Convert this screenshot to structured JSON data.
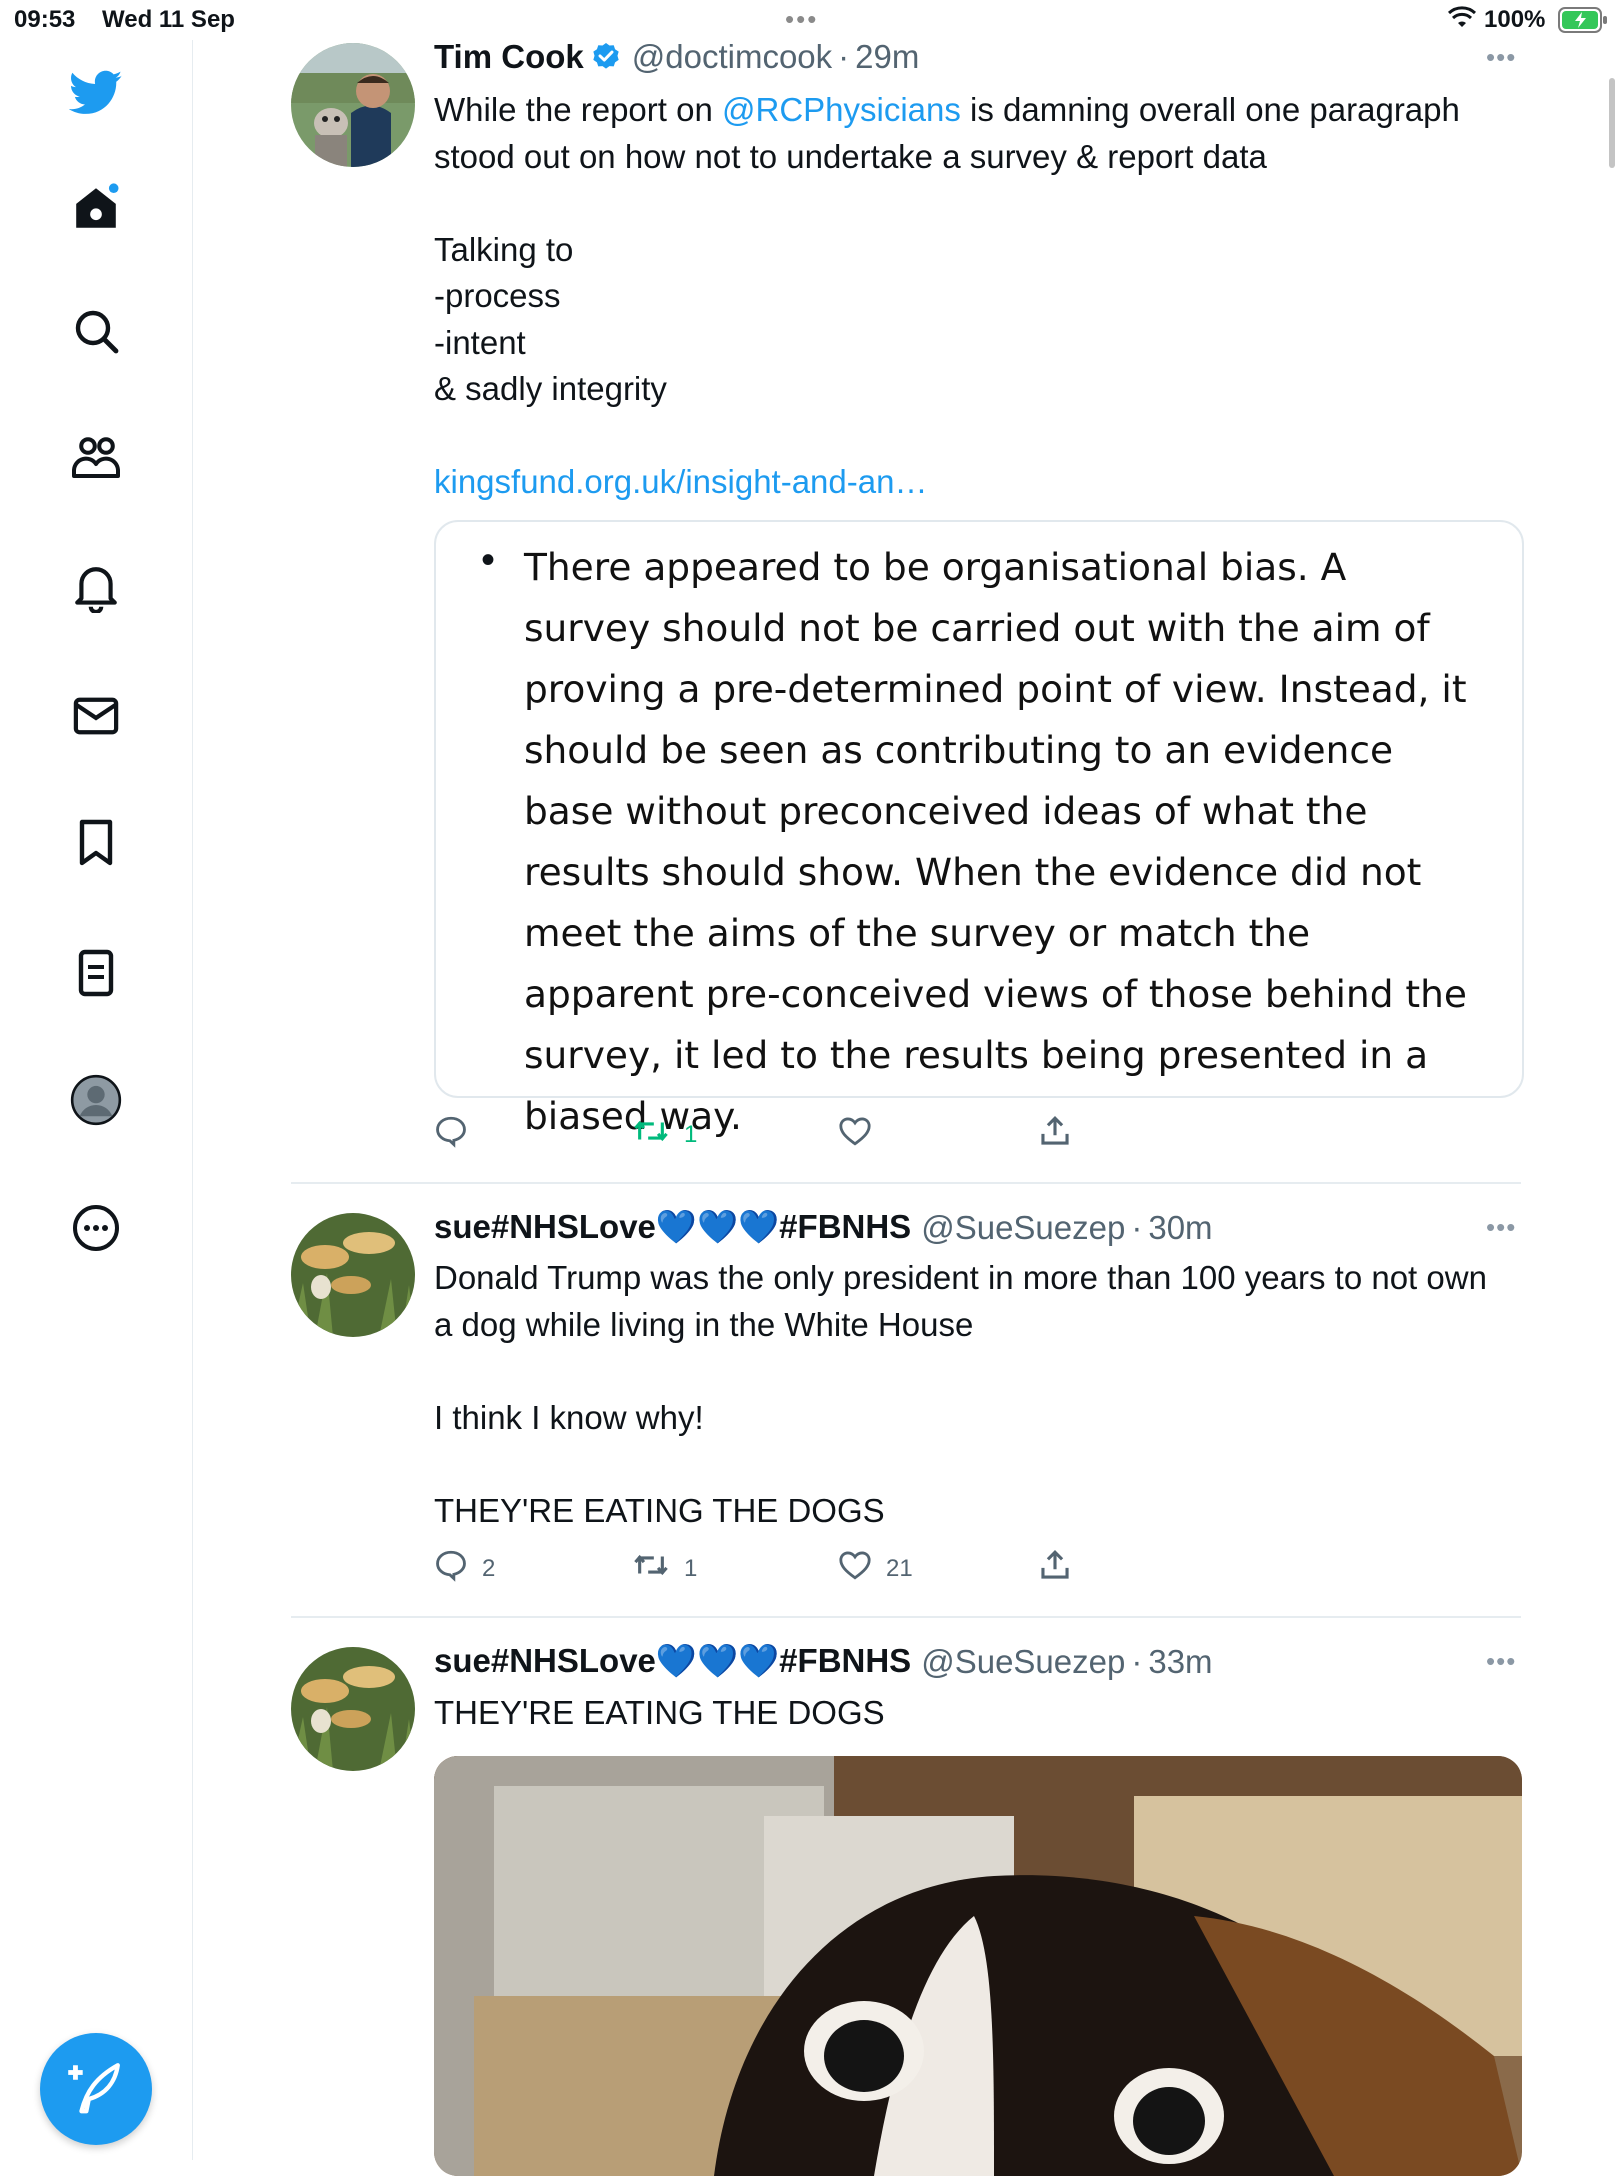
{
  "status_bar": {
    "time": "09:53",
    "date": "Wed 11 Sep",
    "battery": "100%"
  },
  "sidebar": {
    "items": [
      {
        "name": "twitter-logo-icon"
      },
      {
        "name": "home-icon"
      },
      {
        "name": "search-icon"
      },
      {
        "name": "communities-icon"
      },
      {
        "name": "notifications-icon"
      },
      {
        "name": "messages-icon"
      },
      {
        "name": "bookmarks-icon"
      },
      {
        "name": "lists-icon"
      },
      {
        "name": "profile-icon"
      },
      {
        "name": "more-icon"
      }
    ],
    "compose_icon": "compose-tweet-icon"
  },
  "colors": {
    "accent": "#1d9bf0",
    "text": "#0f1419",
    "muted": "#536471",
    "retweet_green": "#00ba7c"
  },
  "tweets": [
    {
      "name": "Tim Cook",
      "verified": true,
      "handle": "@doctimcook",
      "sep": "·",
      "time": "29m",
      "text_pre": "While the report on ",
      "mention": "@RCPhysicians",
      "text_post": " is damning overall one paragraph stood out on how not to undertake a survey & report data\n\nTalking to\n-process\n-intent\n& sadly integrity",
      "link": "kingsfund.org.uk/insight-and-an…",
      "quote_bullet": "•",
      "quote_text": "There appeared to be organisational bias. A survey should not be carried out with the aim of proving a pre-determined point of view. Instead, it should be seen as contributing to an evidence base without preconceived ideas of what the results should show. When the evidence did not meet the aims of the survey or match the apparent pre-conceived views of those behind the survey, it led to the results being presented in a biased way.",
      "replies": "",
      "retweets": "1",
      "likes": ""
    },
    {
      "name": "sue#NHSLove💙💙💙#FBNHS",
      "handle": "@SueSuezep",
      "sep": "·",
      "time": "30m",
      "text": "Donald Trump was the only president in more than 100 years to not own a dog while living in the White House\n\nI think I know why!\n\nTHEY'RE EATING THE DOGS",
      "replies": "2",
      "retweets": "1",
      "likes": "21"
    },
    {
      "name": "sue#NHSLove💙💙💙#FBNHS",
      "handle": "@SueSuezep",
      "sep": "·",
      "time": "33m",
      "text": "THEY'RE EATING THE DOGS",
      "media": "dog-photo"
    }
  ]
}
